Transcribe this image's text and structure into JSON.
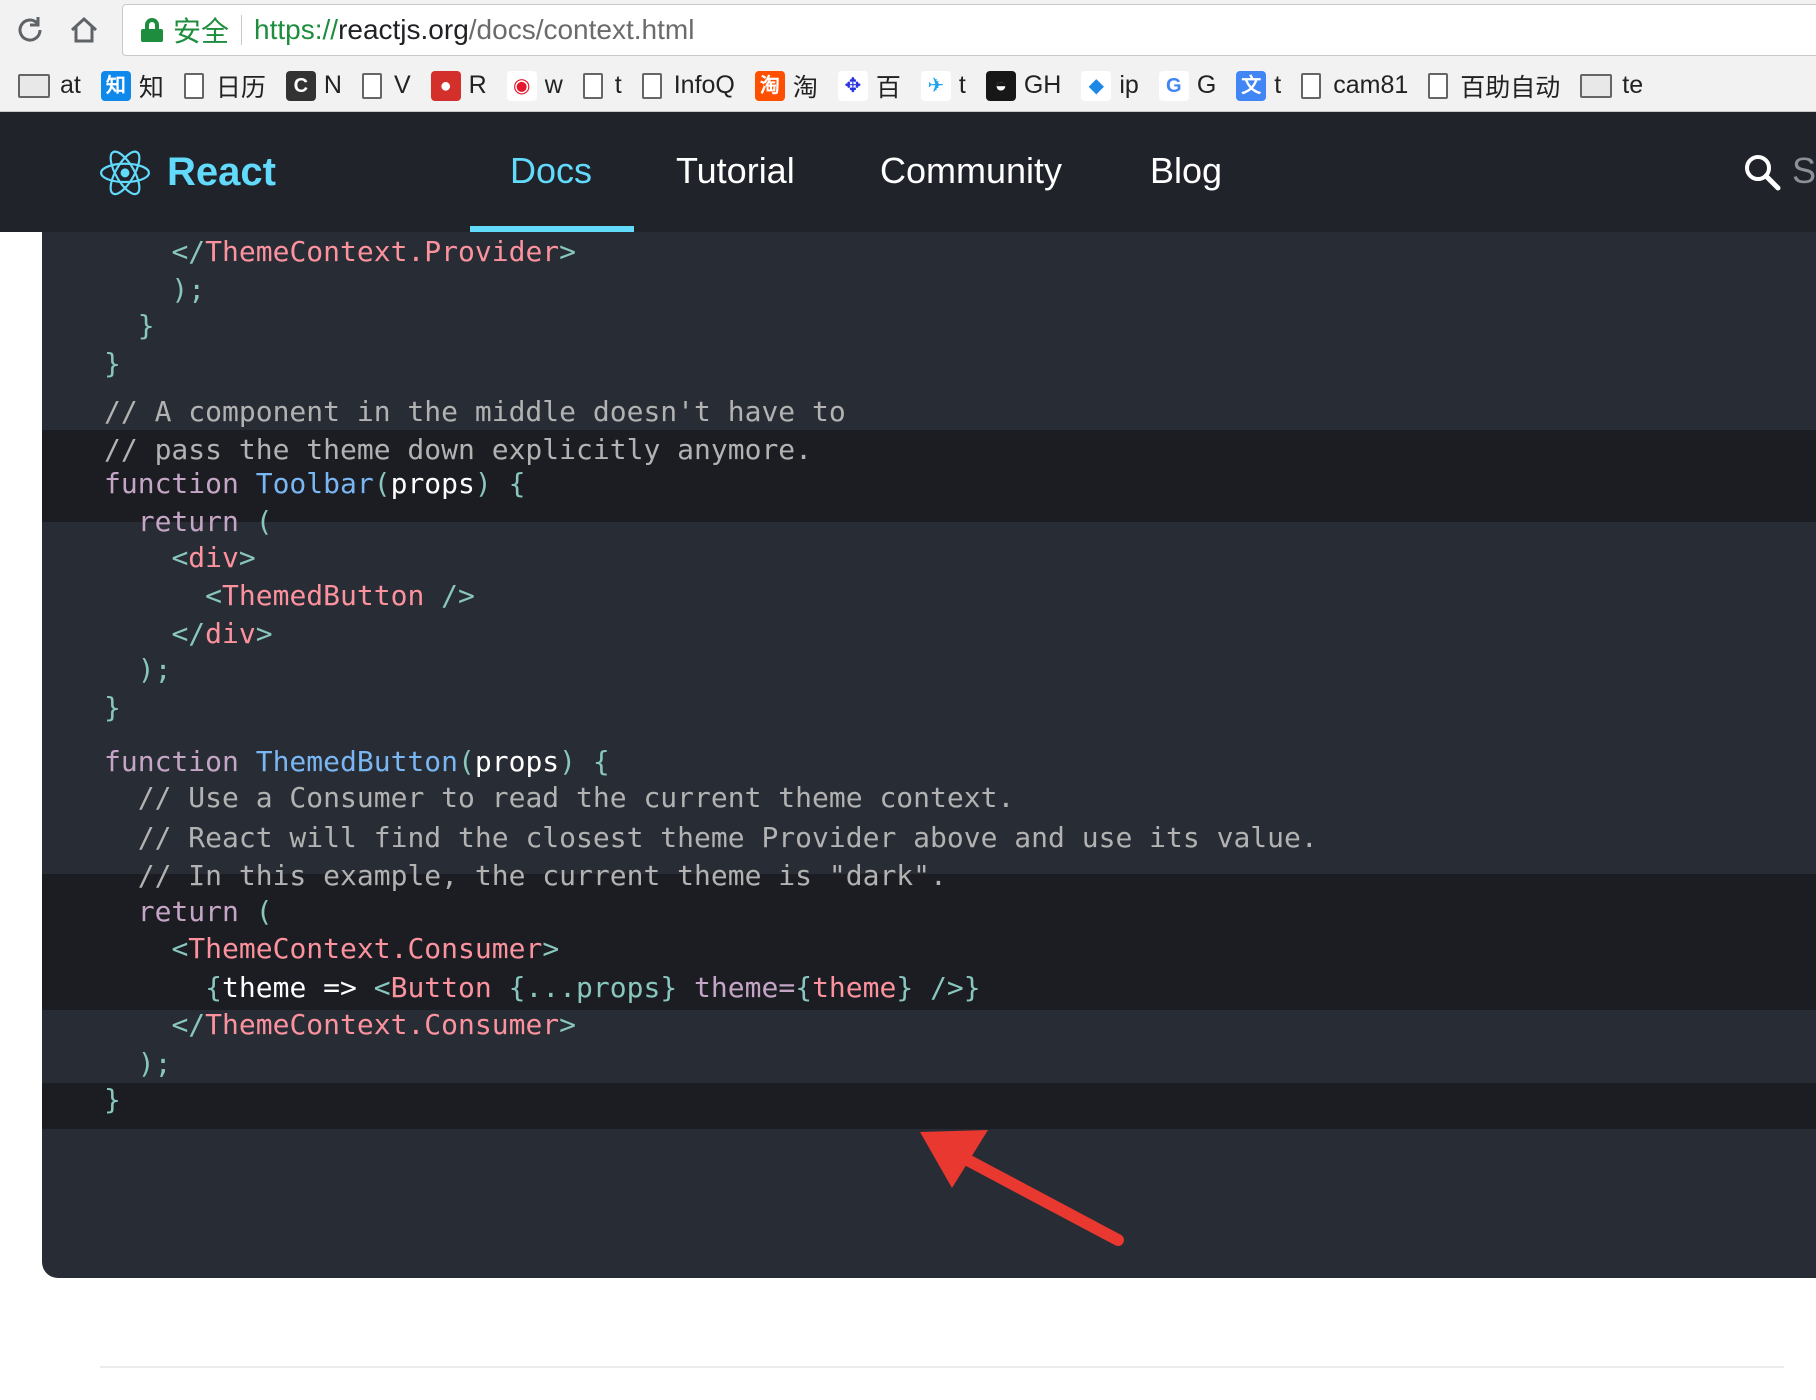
{
  "browser": {
    "secure_label": "安全",
    "url_scheme": "https://",
    "url_host": "reactjs.org",
    "url_path": "/docs/context.html",
    "bookmarks": [
      {
        "label": "at",
        "icon": "folder-icon"
      },
      {
        "label": "知",
        "icon": "zhihu-icon"
      },
      {
        "label": "日历",
        "icon": "page-icon"
      },
      {
        "label": "N",
        "icon": "c-logo-icon"
      },
      {
        "label": "V",
        "icon": "page-icon"
      },
      {
        "label": "R",
        "icon": "red-ball-icon"
      },
      {
        "label": "w",
        "icon": "weibo-icon"
      },
      {
        "label": "t",
        "icon": "page-icon"
      },
      {
        "label": "InfoQ",
        "icon": "page-icon"
      },
      {
        "label": "淘",
        "icon": "taobao-icon"
      },
      {
        "label": "百",
        "icon": "baidu-paw-icon"
      },
      {
        "label": "t",
        "icon": "twitter-icon"
      },
      {
        "label": "GH",
        "icon": "github-icon"
      },
      {
        "label": "ip",
        "icon": "diamond-icon"
      },
      {
        "label": "G",
        "icon": "google-icon"
      },
      {
        "label": "t",
        "icon": "translate-icon"
      },
      {
        "label": "cam81",
        "icon": "page-icon"
      },
      {
        "label": "百助自动",
        "icon": "page-icon"
      },
      {
        "label": "te",
        "icon": "folder-icon"
      }
    ]
  },
  "header": {
    "brand": "React",
    "nav": [
      {
        "label": "Docs",
        "active": true
      },
      {
        "label": "Tutorial",
        "active": false
      },
      {
        "label": "Community",
        "active": false
      },
      {
        "label": "Blog",
        "active": false
      }
    ],
    "search_placeholder": "S"
  },
  "code": {
    "lines": [
      [
        {
          "t": "    ",
          "c": "plain"
        },
        {
          "t": "</",
          "c": "punc"
        },
        {
          "t": "ThemeContext.Provider",
          "c": "tag"
        },
        {
          "t": ">",
          "c": "punc"
        }
      ],
      [
        {
          "t": "   ",
          "c": "plain"
        },
        {
          "t": " );",
          "c": "punc"
        }
      ],
      [
        {
          "t": "  ",
          "c": "plain"
        },
        {
          "t": "}",
          "c": "punc"
        }
      ],
      [
        {
          "t": "}",
          "c": "punc"
        }
      ],
      [
        {
          "t": "",
          "c": "plain"
        }
      ],
      [
        {
          "t": "// A component in the middle doesn't have to",
          "c": "com"
        }
      ],
      [
        {
          "t": "// pass the theme down explicitly anymore.",
          "c": "com"
        }
      ],
      [
        {
          "t": "function ",
          "c": "kw"
        },
        {
          "t": "Toolbar",
          "c": "fn"
        },
        {
          "t": "(",
          "c": "punc"
        },
        {
          "t": "props",
          "c": "plain"
        },
        {
          "t": ") {",
          "c": "punc"
        }
      ],
      [
        {
          "t": "  ",
          "c": "plain"
        },
        {
          "t": "return ",
          "c": "kw"
        },
        {
          "t": "(",
          "c": "punc"
        }
      ],
      [
        {
          "t": "    ",
          "c": "plain"
        },
        {
          "t": "<",
          "c": "punc"
        },
        {
          "t": "div",
          "c": "tag"
        },
        {
          "t": ">",
          "c": "punc"
        }
      ],
      [
        {
          "t": "      ",
          "c": "plain"
        },
        {
          "t": "<",
          "c": "punc"
        },
        {
          "t": "ThemedButton",
          "c": "tag"
        },
        {
          "t": " />",
          "c": "punc"
        }
      ],
      [
        {
          "t": "    ",
          "c": "plain"
        },
        {
          "t": "</",
          "c": "punc"
        },
        {
          "t": "div",
          "c": "tag"
        },
        {
          "t": ">",
          "c": "punc"
        }
      ],
      [
        {
          "t": "  ",
          "c": "plain"
        },
        {
          "t": ");",
          "c": "punc"
        }
      ],
      [
        {
          "t": "}",
          "c": "punc"
        }
      ],
      [
        {
          "t": "",
          "c": "plain"
        }
      ],
      [
        {
          "t": "function ",
          "c": "kw"
        },
        {
          "t": "ThemedButton",
          "c": "fn"
        },
        {
          "t": "(",
          "c": "punc"
        },
        {
          "t": "props",
          "c": "plain"
        },
        {
          "t": ") {",
          "c": "punc"
        }
      ],
      [
        {
          "t": "  ",
          "c": "plain"
        },
        {
          "t": "// Use a Consumer to read the current theme context.",
          "c": "com"
        }
      ],
      [
        {
          "t": "  ",
          "c": "plain"
        },
        {
          "t": "// React will find the closest theme Provider above and use its value.",
          "c": "com"
        }
      ],
      [
        {
          "t": "  ",
          "c": "plain"
        },
        {
          "t": "// In this example, the current theme is \"dark\".",
          "c": "com"
        }
      ],
      [
        {
          "t": "  ",
          "c": "plain"
        },
        {
          "t": "return ",
          "c": "kw"
        },
        {
          "t": "(",
          "c": "punc"
        }
      ],
      [
        {
          "t": "    ",
          "c": "plain"
        },
        {
          "t": "<",
          "c": "punc"
        },
        {
          "t": "ThemeContext.Consumer",
          "c": "tag"
        },
        {
          "t": ">",
          "c": "punc"
        }
      ],
      [
        {
          "t": "      ",
          "c": "plain"
        },
        {
          "t": "{",
          "c": "punc"
        },
        {
          "t": "theme => ",
          "c": "plain"
        },
        {
          "t": "<",
          "c": "punc"
        },
        {
          "t": "Button",
          "c": "tag"
        },
        {
          "t": " {...props}",
          "c": "punc"
        },
        {
          "t": " theme=",
          "c": "kw"
        },
        {
          "t": "{",
          "c": "punc"
        },
        {
          "t": "theme",
          "c": "tag"
        },
        {
          "t": "}",
          "c": "punc"
        },
        {
          "t": " />}",
          "c": "punc"
        }
      ],
      [
        {
          "t": "    ",
          "c": "plain"
        },
        {
          "t": "</",
          "c": "punc"
        },
        {
          "t": "ThemeContext.Consumer",
          "c": "tag"
        },
        {
          "t": ">",
          "c": "punc"
        }
      ],
      [
        {
          "t": "  ",
          "c": "plain"
        },
        {
          "t": ");",
          "c": "punc"
        }
      ],
      [
        {
          "t": "}",
          "c": "punc"
        }
      ]
    ]
  },
  "annotation": {
    "color": "#e8382f",
    "icon": "red-arrow-icon"
  },
  "colors": {
    "header_bg": "#20232a",
    "accent": "#61dafb",
    "code_bg": "#282c34",
    "highlight_bg": "#1b1d22"
  }
}
